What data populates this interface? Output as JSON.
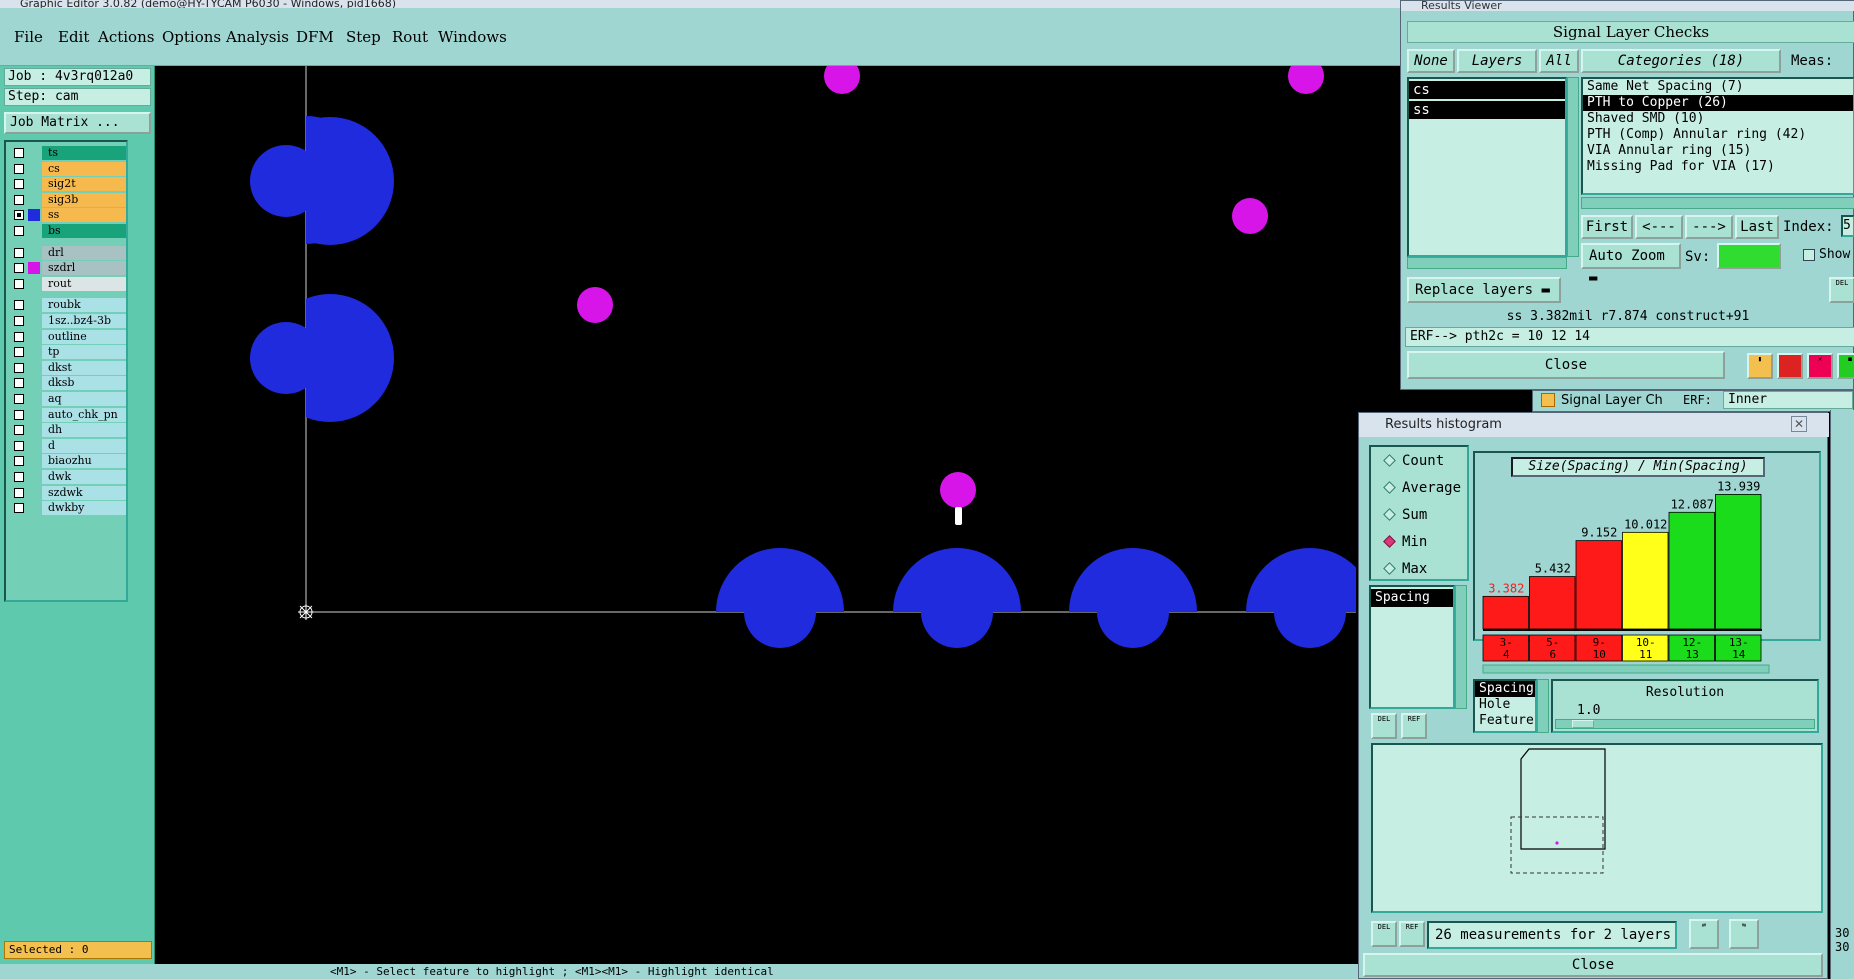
{
  "editor": {
    "title": "Graphic Editor 3.0.82 (demo@HY-TYCAM P6030 - Windows, pid1668)",
    "menu": [
      "File",
      "Edit",
      "Actions",
      "Options",
      "Analysis",
      "DFM",
      "Step",
      "Rout",
      "Windows"
    ],
    "job_label": "Job : 4v3rq012a0",
    "step_label": "Step: cam",
    "job_matrix_button": "Job Matrix ...",
    "selected_label": "Selected : 0",
    "status_prompt": "<M1> - Select feature to highlight ; <M1><M1> - Highlight identical",
    "layers": [
      {
        "name": "ts",
        "color": "#19a37a",
        "checked": false,
        "swatch": ""
      },
      {
        "name": "cs",
        "color": "#f5b94d",
        "checked": false,
        "swatch": ""
      },
      {
        "name": "sig2t",
        "color": "#f5b94d",
        "checked": false,
        "swatch": ""
      },
      {
        "name": "sig3b",
        "color": "#f5b94d",
        "checked": false,
        "swatch": ""
      },
      {
        "name": "ss",
        "color": "#f5b94d",
        "checked": true,
        "swatch": "#1f2bdd"
      },
      {
        "name": "bs",
        "color": "#19a37a",
        "checked": false,
        "swatch": ""
      },
      {
        "name": "drl",
        "color": "#a8c2c4",
        "checked": false,
        "swatch": ""
      },
      {
        "name": "szdrl",
        "color": "#a8c2c4",
        "checked": false,
        "swatch": "#d715e8"
      },
      {
        "name": "rout",
        "color": "#dbe5e6",
        "checked": false,
        "swatch": ""
      },
      {
        "name": "roubk",
        "color": "#a9e1e6",
        "checked": false,
        "swatch": ""
      },
      {
        "name": "1sz..bz4-3b",
        "color": "#a9e1e6",
        "checked": false,
        "swatch": ""
      },
      {
        "name": "outline",
        "color": "#a9e1e6",
        "checked": false,
        "swatch": ""
      },
      {
        "name": "tp",
        "color": "#a9e1e6",
        "checked": false,
        "swatch": ""
      },
      {
        "name": "dkst",
        "color": "#a9e1e6",
        "checked": false,
        "swatch": ""
      },
      {
        "name": "dksb",
        "color": "#a9e1e6",
        "checked": false,
        "swatch": ""
      },
      {
        "name": "aq",
        "color": "#a9e1e6",
        "checked": false,
        "swatch": ""
      },
      {
        "name": "auto_chk_pn",
        "color": "#a9e1e6",
        "checked": false,
        "swatch": ""
      },
      {
        "name": "dh",
        "color": "#a9e1e6",
        "checked": false,
        "swatch": ""
      },
      {
        "name": "d",
        "color": "#a9e1e6",
        "checked": false,
        "swatch": ""
      },
      {
        "name": "biaozhu",
        "color": "#a9e1e6",
        "checked": false,
        "swatch": ""
      },
      {
        "name": "dwk",
        "color": "#a9e1e6",
        "checked": false,
        "swatch": ""
      },
      {
        "name": "szdwk",
        "color": "#a9e1e6",
        "checked": false,
        "swatch": ""
      },
      {
        "name": "dwkby",
        "color": "#a9e1e6",
        "checked": false,
        "swatch": ""
      }
    ]
  },
  "results_viewer": {
    "title": "Results Viewer",
    "header": "Signal Layer Checks",
    "none_btn": "None",
    "layers_btn": "Layers",
    "all_btn": "All",
    "categories_btn": "Categories (18)",
    "meas_label": "Meas:",
    "layer_items": [
      "cs",
      "ss"
    ],
    "categories": [
      "Same Net Spacing (7)",
      "PTH to Copper (26)",
      "Shaved SMD (10)",
      "PTH (Comp) Annular ring (42)",
      "VIA Annular ring (15)",
      "Missing Pad for VIA (17)"
    ],
    "selected_category": 1,
    "first_btn": "First",
    "prev_btn": "<---",
    "next_btn": "--->",
    "last_btn": "Last",
    "index_label": "Index:",
    "index_value": "5",
    "auto_zoom_btn": "Auto Zoom",
    "sv_label": "Sv:",
    "show_label": "Show",
    "replace_layers_btn": "Replace layers",
    "measurement_line": "ss 3.382mil  r7.874  construct+91",
    "erf_line": "ERF--> pth2c = 10 12 14",
    "close_btn": "Close",
    "sv_color": "#2fdc2f"
  },
  "background_window": {
    "title_snippet": "Signal Layer Ch",
    "erf_label": "ERF:",
    "inner_value": "Inner"
  },
  "histogram": {
    "title": "Results histogram",
    "modes": [
      "Count",
      "Average",
      "Sum",
      "Min",
      "Max"
    ],
    "selected_mode": "Min",
    "measure_list": [
      "Spacing"
    ],
    "type_list": [
      "Spacing",
      "Hole",
      "Feature"
    ],
    "resolution_label": "Resolution",
    "resolution_value": "1.0",
    "status": "26 measurements for 2 layers",
    "close_btn": "Close",
    "side_numbers": [
      "30",
      "30"
    ]
  },
  "chart_data": {
    "type": "bar",
    "title": "Size(Spacing) / Min(Spacing)",
    "categories": [
      "3-4",
      "5-6",
      "9-10",
      "10-11",
      "12-13",
      "13-14"
    ],
    "values": [
      3.382,
      5.432,
      9.152,
      10.012,
      12.087,
      13.939
    ],
    "value_labels": [
      "3.382",
      "5.432",
      "9.152",
      "10.012",
      "12.087",
      "13.939"
    ],
    "bar_colors": [
      "#ff1a1a",
      "#ff1a1a",
      "#ff1a1a",
      "#ffff1a",
      "#1adc1a",
      "#1adc1a"
    ],
    "first_label_color": "#ff1a1a",
    "ylim": [
      0,
      14.5
    ],
    "grid": false
  }
}
